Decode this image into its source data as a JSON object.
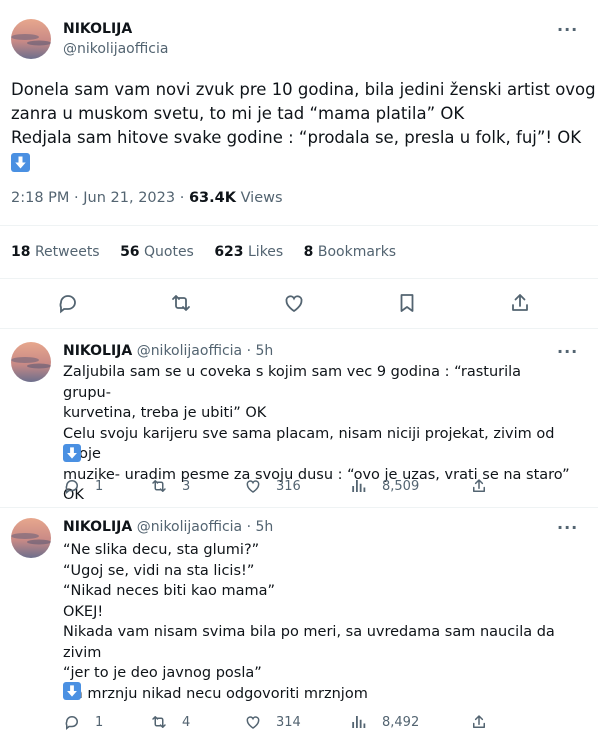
{
  "main_tweet": {
    "display_name": "NIKOLIJA",
    "handle": "@nikolijaofficia",
    "text": "Donela sam vam novi zvuk pre 10 godina, bila jedini ženski artist ovog\nzanra u muskom svetu, to mi je tad “mama platila” OK\nRedjala sam hitove svake godine : “prodala se, presla u folk, fuj”! OK",
    "emoji": "down-arrow-emoji",
    "time": "2:18 PM",
    "date": "Jun 21, 2023",
    "views_count": "63.4K",
    "views_label": "Views",
    "retweets_count": "18",
    "retweets_label": "Retweets",
    "quotes_count": "56",
    "quotes_label": "Quotes",
    "likes_count": "623",
    "likes_label": "Likes",
    "bookmarks_count": "8",
    "bookmarks_label": "Bookmarks"
  },
  "replies": [
    {
      "display_name": "NIKOLIJA",
      "handle": "@nikolijaofficia",
      "time_ago": "5h",
      "text": "Zaljubila sam se u coveka s kojim sam vec 9 godina : “rasturila grupu-\nkurvetina, treba je ubiti” OK\nCelu svoju karijeru sve sama placam, nisam niciji projekat, zivim od svoje\nmuzike- uradim pesme za svoju dusu : “ovo je uzas, vrati se na staro” OK",
      "replies": "1",
      "retweets": "3",
      "likes": "316",
      "views": "8,509"
    },
    {
      "display_name": "NIKOLIJA",
      "handle": "@nikolijaofficia",
      "time_ago": "5h",
      "text": "“Ne slika decu, sta glumi?”\n“Ugoj se, vidi na sta licis!”\n“Nikad neces biti kao mama”\nOKEJ!\nNikada vam nisam svima bila po meri, sa uvredama sam naucila da zivim\n“jer to je deo javnog posla”\nNa mrznju nikad necu odgovoriti mrznjom",
      "replies": "1",
      "retweets": "4",
      "likes": "314",
      "views": "8,492"
    }
  ],
  "colors": {
    "text": "#0f1419",
    "muted": "#536471",
    "divider": "#eff3f4",
    "emoji_blue": "#4a90e2"
  }
}
